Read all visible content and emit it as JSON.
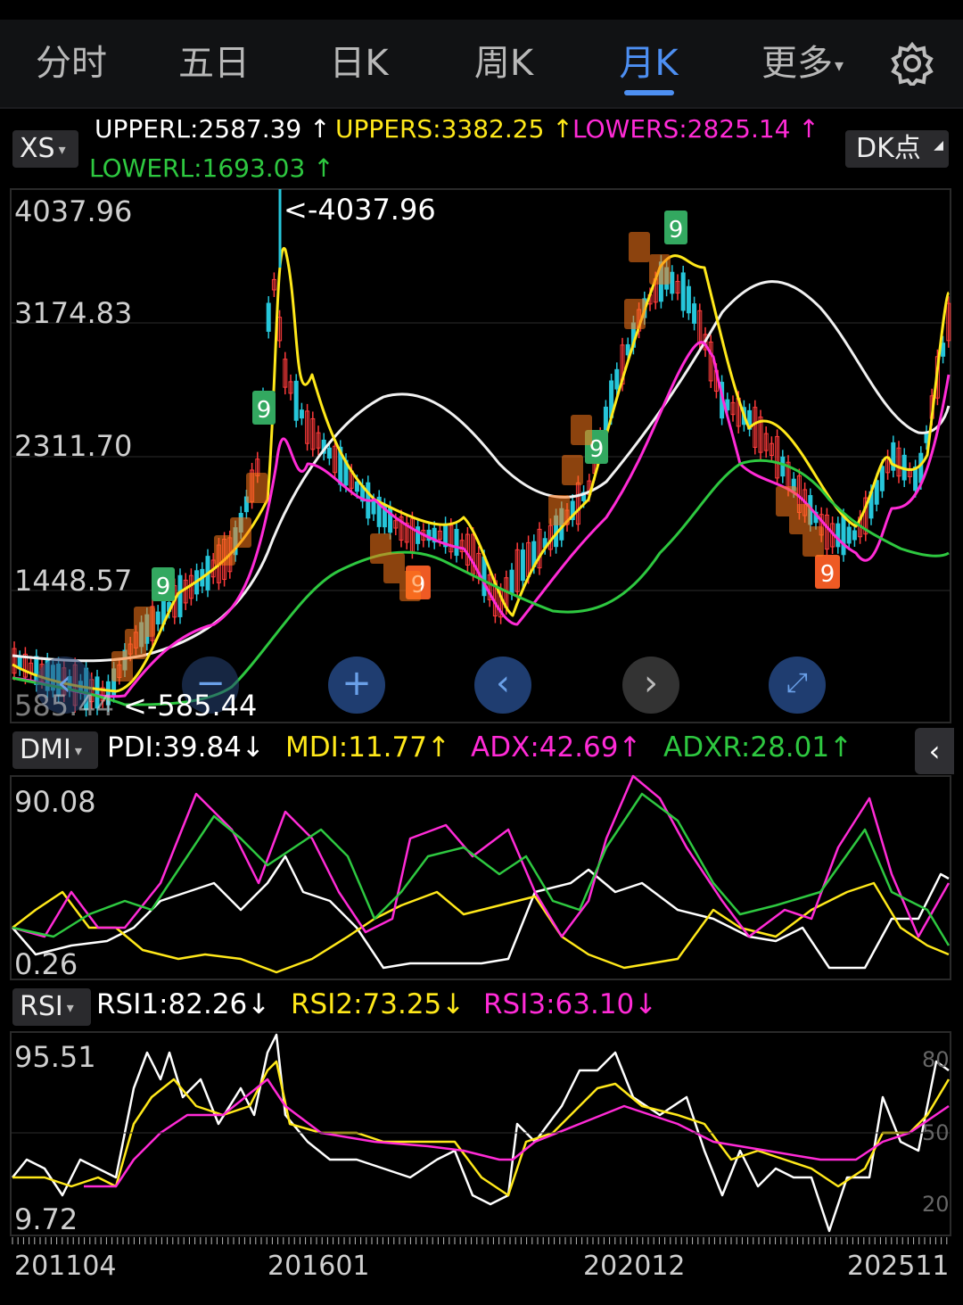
{
  "tabs": [
    {
      "label": "分时",
      "active": false
    },
    {
      "label": "五日",
      "active": false
    },
    {
      "label": "日K",
      "active": false
    },
    {
      "label": "周K",
      "active": false
    },
    {
      "label": "月K",
      "active": true
    },
    {
      "label": "更多",
      "active": false
    }
  ],
  "settings_icon": "gear-icon",
  "main_panel": {
    "indicator": "XS",
    "values": [
      {
        "label": "UPPERL:2587.39",
        "arrow": "↑",
        "color": "#ffffff"
      },
      {
        "label": "UPPERS:3382.25",
        "arrow": "↑",
        "color": "#ffe81a"
      },
      {
        "label": "LOWERS:2825.14",
        "arrow": "↑",
        "color": "#ff2bd6"
      },
      {
        "label": "LOWERL:1693.03",
        "arrow": "↑",
        "color": "#2ec840"
      }
    ],
    "dk_button": "DK点",
    "y_ticks": [
      "4037.96",
      "3174.83",
      "2311.70",
      "1448.57",
      "585.44"
    ],
    "high_marker": "<-4037.96",
    "low_marker": "<-585.44",
    "nine_labels": [
      "9",
      "9",
      "9",
      "9",
      "9"
    ]
  },
  "zoom_controls": [
    {
      "name": "zoom-out-left-icon",
      "glyph": "‹"
    },
    {
      "name": "minus-icon",
      "glyph": "−"
    },
    {
      "name": "plus-icon",
      "glyph": "+"
    },
    {
      "name": "scroll-left-icon",
      "glyph": "‹"
    },
    {
      "name": "scroll-right-icon",
      "glyph": "›"
    },
    {
      "name": "fullscreen-icon",
      "glyph": "⤢"
    }
  ],
  "dmi_panel": {
    "indicator": "DMI",
    "values": [
      {
        "label": "PDI:39.84",
        "arrow": "↓",
        "color": "#ffffff"
      },
      {
        "label": "MDI:11.77",
        "arrow": "↑",
        "color": "#ffe81a"
      },
      {
        "label": "ADX:42.69",
        "arrow": "↑",
        "color": "#ff2bd6"
      },
      {
        "label": "ADXR:28.01",
        "arrow": "↑",
        "color": "#2ec840"
      }
    ],
    "y_ticks": [
      "90.08",
      "0.26"
    ]
  },
  "rsi_panel": {
    "indicator": "RSI",
    "values": [
      {
        "label": "RSI1:82.26",
        "arrow": "↓",
        "color": "#ffffff"
      },
      {
        "label": "RSI2:73.25",
        "arrow": "↓",
        "color": "#ffe81a"
      },
      {
        "label": "RSI3:63.10",
        "arrow": "↓",
        "color": "#ff2bd6"
      }
    ],
    "y_ticks": [
      "95.51",
      "9.72"
    ],
    "right_ticks": [
      "80",
      "50",
      "20"
    ]
  },
  "x_ticks": [
    "201104",
    "201601",
    "202012",
    "202511"
  ],
  "chart_data": {
    "type": "line",
    "title": "",
    "x": [
      "201104",
      "201601",
      "202012",
      "202511"
    ],
    "ylim": [
      585.44,
      4037.96
    ],
    "series": [
      {
        "name": "UPPERL",
        "color": "#ffffff",
        "values": [
          850,
          1050,
          1500,
          2150,
          2780,
          2300,
          1800,
          1830,
          2950,
          3220,
          2800,
          2370,
          2587.39
        ]
      },
      {
        "name": "UPPERS",
        "color": "#ffe81a",
        "values": [
          640,
          1350,
          3800,
          2150,
          1880,
          1650,
          3450,
          2200,
          2000,
          1520,
          3382.25
        ]
      },
      {
        "name": "LOWERS",
        "color": "#ff2bd6",
        "values": [
          600,
          1200,
          3000,
          1900,
          1700,
          1300,
          3000,
          2000,
          1500,
          2825.14
        ]
      },
      {
        "name": "LOWERL",
        "color": "#2ec840",
        "values": [
          590,
          650,
          1450,
          1850,
          1350,
          2350,
          2200,
          1650,
          1693.03
        ]
      }
    ],
    "dmi": {
      "ylim": [
        0.26,
        90.08
      ],
      "PDI": 39.84,
      "MDI": 11.77,
      "ADX": 42.69,
      "ADXR": 28.01
    },
    "rsi": {
      "ylim": [
        9.72,
        95.51
      ],
      "RSI1": 82.26,
      "RSI2": 73.25,
      "RSI3": 63.1
    }
  }
}
